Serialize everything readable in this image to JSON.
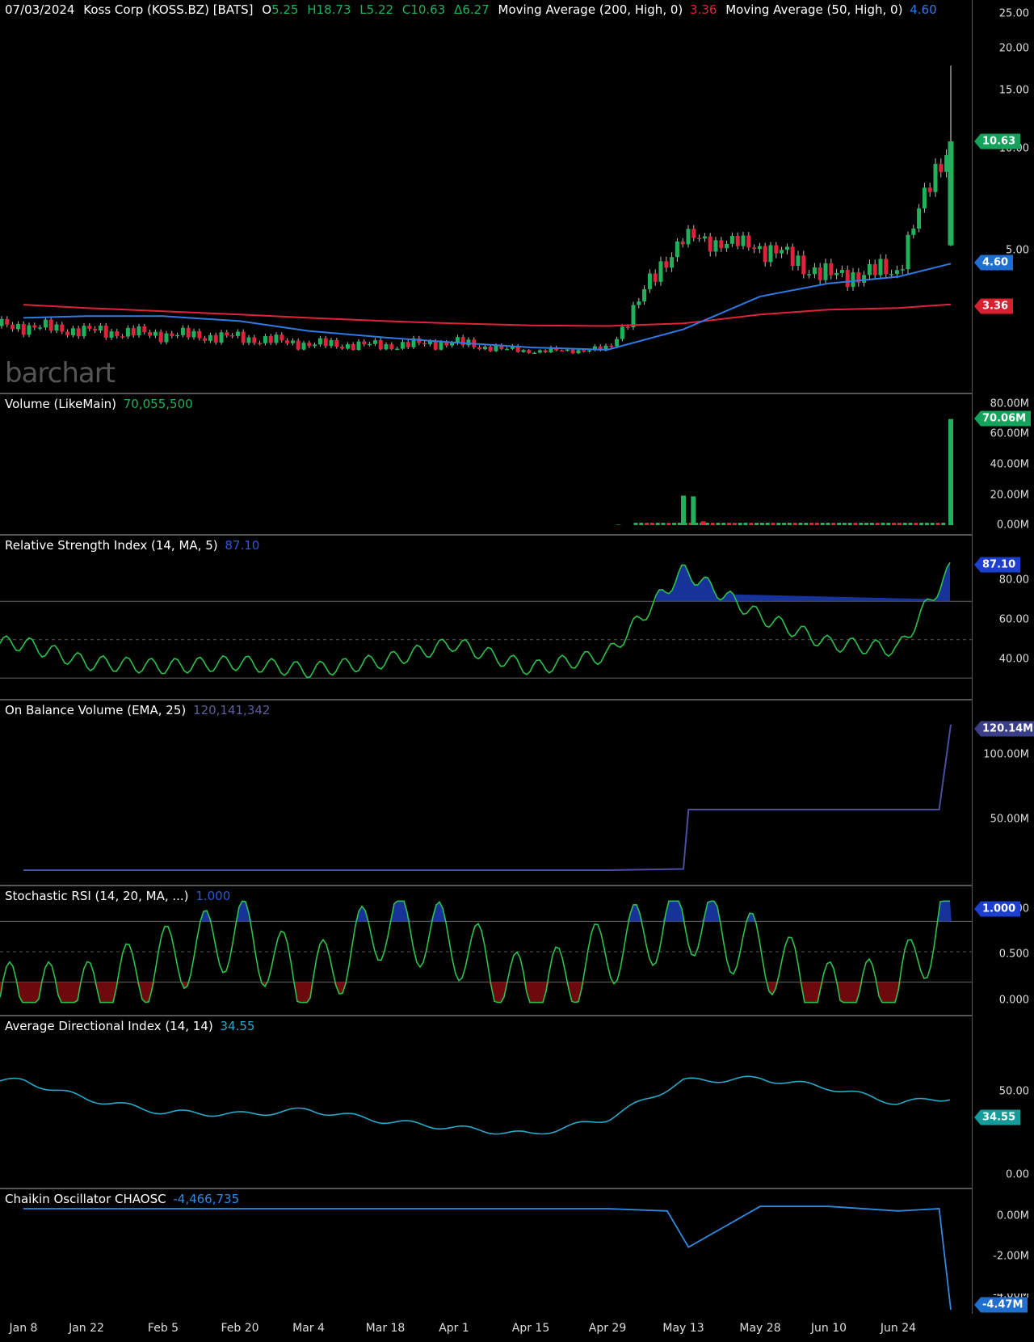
{
  "header": {
    "date": "07/03/2024",
    "symbol": "Koss Corp (KOSS.BZ) [BATS]",
    "o_label": "O",
    "o": "5.25",
    "h_label": "H",
    "h": "18.73",
    "l_label": "L",
    "l": "5.22",
    "c_label": "C",
    "c": "10.63",
    "d_label": "Δ",
    "d": "6.27",
    "ma200_label": "Moving Average  (200, High, 0)",
    "ma200": "3.36",
    "ma50_label": "Moving Average  (50, High, 0)",
    "ma50": "4.60"
  },
  "watermark": "barchart",
  "colors": {
    "up": "#20b15a",
    "down": "#e0233a",
    "ma200": "#e0233a",
    "ma50": "#2f7ae5",
    "rsi_line": "#2cc24c",
    "rsi_fill": "#1d3fbf",
    "obv": "#4a4ea0",
    "adx": "#2aa8c8",
    "chaikin": "#2f8ae0",
    "osc_low": "#7a0a10",
    "badge_price": "#13a35a",
    "badge_ma50": "#1f6fd0",
    "badge_ma200": "#d8202f",
    "badge_rsi": "#1c3fd0",
    "badge_obv": "#3b3f8a",
    "badge_adx": "#139c9a",
    "badge_chaikin": "#1f6fd0"
  },
  "panes": {
    "price": {
      "ticks": [
        "25.00",
        "20.00",
        "15.00",
        "10.00",
        "5.00"
      ],
      "badges": {
        "close": "10.63",
        "ma50": "4.60",
        "ma200": "3.36"
      }
    },
    "volume": {
      "label": "Volume  (LikeMain)",
      "value": "70,055,500",
      "ticks": [
        "80.00M",
        "60.00M",
        "40.00M",
        "20.00M",
        "0.00M"
      ],
      "badge": "70.06M"
    },
    "rsi": {
      "label": "Relative Strength Index  (14, MA, 5)",
      "value": "87.10",
      "ticks": [
        "80.00",
        "60.00",
        "40.00"
      ],
      "badge": "87.10"
    },
    "obv": {
      "label": "On Balance Volume  (EMA, 25)",
      "value": "120,141,342",
      "ticks": [
        "100.00M",
        "50.00M"
      ],
      "badge": "120.14M"
    },
    "stochrsi": {
      "label": "Stochastic RSI  (14, 20, MA, ...)",
      "value": "1.000",
      "ticks": [
        "1.000",
        "0.500",
        "0.000"
      ],
      "badge": "1.000"
    },
    "adx": {
      "label": "Average Directional Index  (14, 14)",
      "value": "34.55",
      "ticks": [
        "50.00",
        "0.00"
      ],
      "badge": "34.55"
    },
    "chaikin": {
      "label": "Chaikin Oscillator CHAOSC",
      "value": "-4,466,735",
      "ticks": [
        "0.00M",
        "-2.00M",
        "-4.00M"
      ],
      "badge": "-4.47M"
    }
  },
  "x_ticks": [
    "Jan 8",
    "Jan 22",
    "Feb 5",
    "Feb 20",
    "Mar 4",
    "Mar 18",
    "Apr 1",
    "Apr 15",
    "Apr 29",
    "May 13",
    "May 28",
    "Jun 10",
    "Jun 24"
  ],
  "chart_data": [
    {
      "type": "candlestick",
      "title": "07/03/2024 Koss Corp (KOSS.BZ) [BATS]",
      "ylim": [
        0,
        25
      ],
      "x": [
        "Jan 8",
        "Jan 22",
        "Feb 5",
        "Feb 20",
        "Mar 4",
        "Mar 18",
        "Apr 1",
        "Apr 15",
        "Apr 29",
        "May 13",
        "May 28",
        "Jun 10",
        "Jun 24",
        "Jul 3"
      ],
      "close": [
        2.7,
        2.55,
        2.45,
        2.35,
        2.15,
        2.1,
        2.2,
        1.85,
        1.95,
        5.6,
        5.2,
        4.2,
        4.4,
        10.63
      ],
      "last_ohlc": {
        "open": 5.25,
        "high": 18.73,
        "low": 5.22,
        "close": 10.63
      },
      "series": [
        {
          "name": "Moving Average  (200, High, 0)",
          "values": [
            3.35,
            3.25,
            3.15,
            3.05,
            2.95,
            2.85,
            2.78,
            2.72,
            2.7,
            2.78,
            3.05,
            3.2,
            3.25,
            3.36
          ]
        },
        {
          "name": "Moving Average  (50, High, 0)",
          "values": [
            2.95,
            3.0,
            3.0,
            2.85,
            2.55,
            2.35,
            2.2,
            2.05,
            1.95,
            2.6,
            3.6,
            4.0,
            4.2,
            4.6
          ]
        }
      ]
    },
    {
      "type": "bar",
      "title": "Volume  (LikeMain)",
      "ylim": [
        0,
        80000000
      ],
      "x": [
        "May 1",
        "May 13",
        "May 14",
        "May 15",
        "Jul 3"
      ],
      "values": [
        300000,
        19500000,
        19000000,
        2500000,
        70055500
      ]
    },
    {
      "type": "line",
      "title": "Relative Strength Index  (14, MA, 5)",
      "ylim": [
        20,
        100
      ],
      "x": [
        "Jan 8",
        "Jan 22",
        "Feb 5",
        "Feb 20",
        "Mar 4",
        "Mar 18",
        "Apr 1",
        "Apr 15",
        "Apr 29",
        "May 13",
        "May 28",
        "Jun 10",
        "Jun 24",
        "Jul 3"
      ],
      "values": [
        48,
        38,
        36,
        38,
        34,
        39,
        48,
        35,
        42,
        86,
        62,
        48,
        45,
        87.1
      ]
    },
    {
      "type": "line",
      "title": "On Balance Volume  (EMA, 25)",
      "ylim": [
        0,
        130000000
      ],
      "x": [
        "Jan 8",
        "Apr 29",
        "May 13",
        "May 14",
        "Jun 24",
        "Jul 1",
        "Jul 3"
      ],
      "values": [
        0,
        0,
        1000000,
        50000000,
        50000000,
        50000000,
        120141342
      ]
    },
    {
      "type": "line",
      "title": "Stochastic RSI  (14, 20, MA, ...)",
      "ylim": [
        -0.05,
        1.05
      ],
      "x": [
        "Jan 8",
        "Jan 22",
        "Feb 5",
        "Feb 20",
        "Mar 4",
        "Mar 18",
        "Apr 1",
        "Apr 15",
        "Apr 29",
        "May 13",
        "May 28",
        "Jun 10",
        "Jun 24",
        "Jul 3"
      ],
      "values": [
        0.05,
        0.05,
        0.4,
        0.7,
        0.15,
        0.8,
        0.6,
        0.05,
        0.5,
        0.85,
        0.5,
        0.05,
        0.1,
        1.0
      ]
    },
    {
      "type": "line",
      "title": "Average Directional Index  (14, 14)",
      "ylim": [
        0,
        60
      ],
      "x": [
        "Jan 8",
        "Jan 22",
        "Feb 5",
        "Feb 20",
        "Mar 4",
        "Mar 18",
        "Apr 1",
        "Apr 15",
        "Apr 29",
        "May 13",
        "May 28",
        "Jun 10",
        "Jun 24",
        "Jul 3"
      ],
      "values": [
        42,
        34,
        28,
        27,
        29,
        24,
        21,
        18,
        25,
        42,
        43,
        39,
        32,
        34.55
      ]
    },
    {
      "type": "line",
      "title": "Chaikin Oscillator CHAOSC",
      "ylim": [
        -4500000,
        500000
      ],
      "x": [
        "Jan 8",
        "Apr 29",
        "May 10",
        "May 14",
        "May 28",
        "Jun 10",
        "Jun 24",
        "Jul 1",
        "Jul 3"
      ],
      "values": [
        0,
        0,
        -100000,
        -1700000,
        100000,
        100000,
        -100000,
        0,
        -4466735
      ]
    }
  ]
}
